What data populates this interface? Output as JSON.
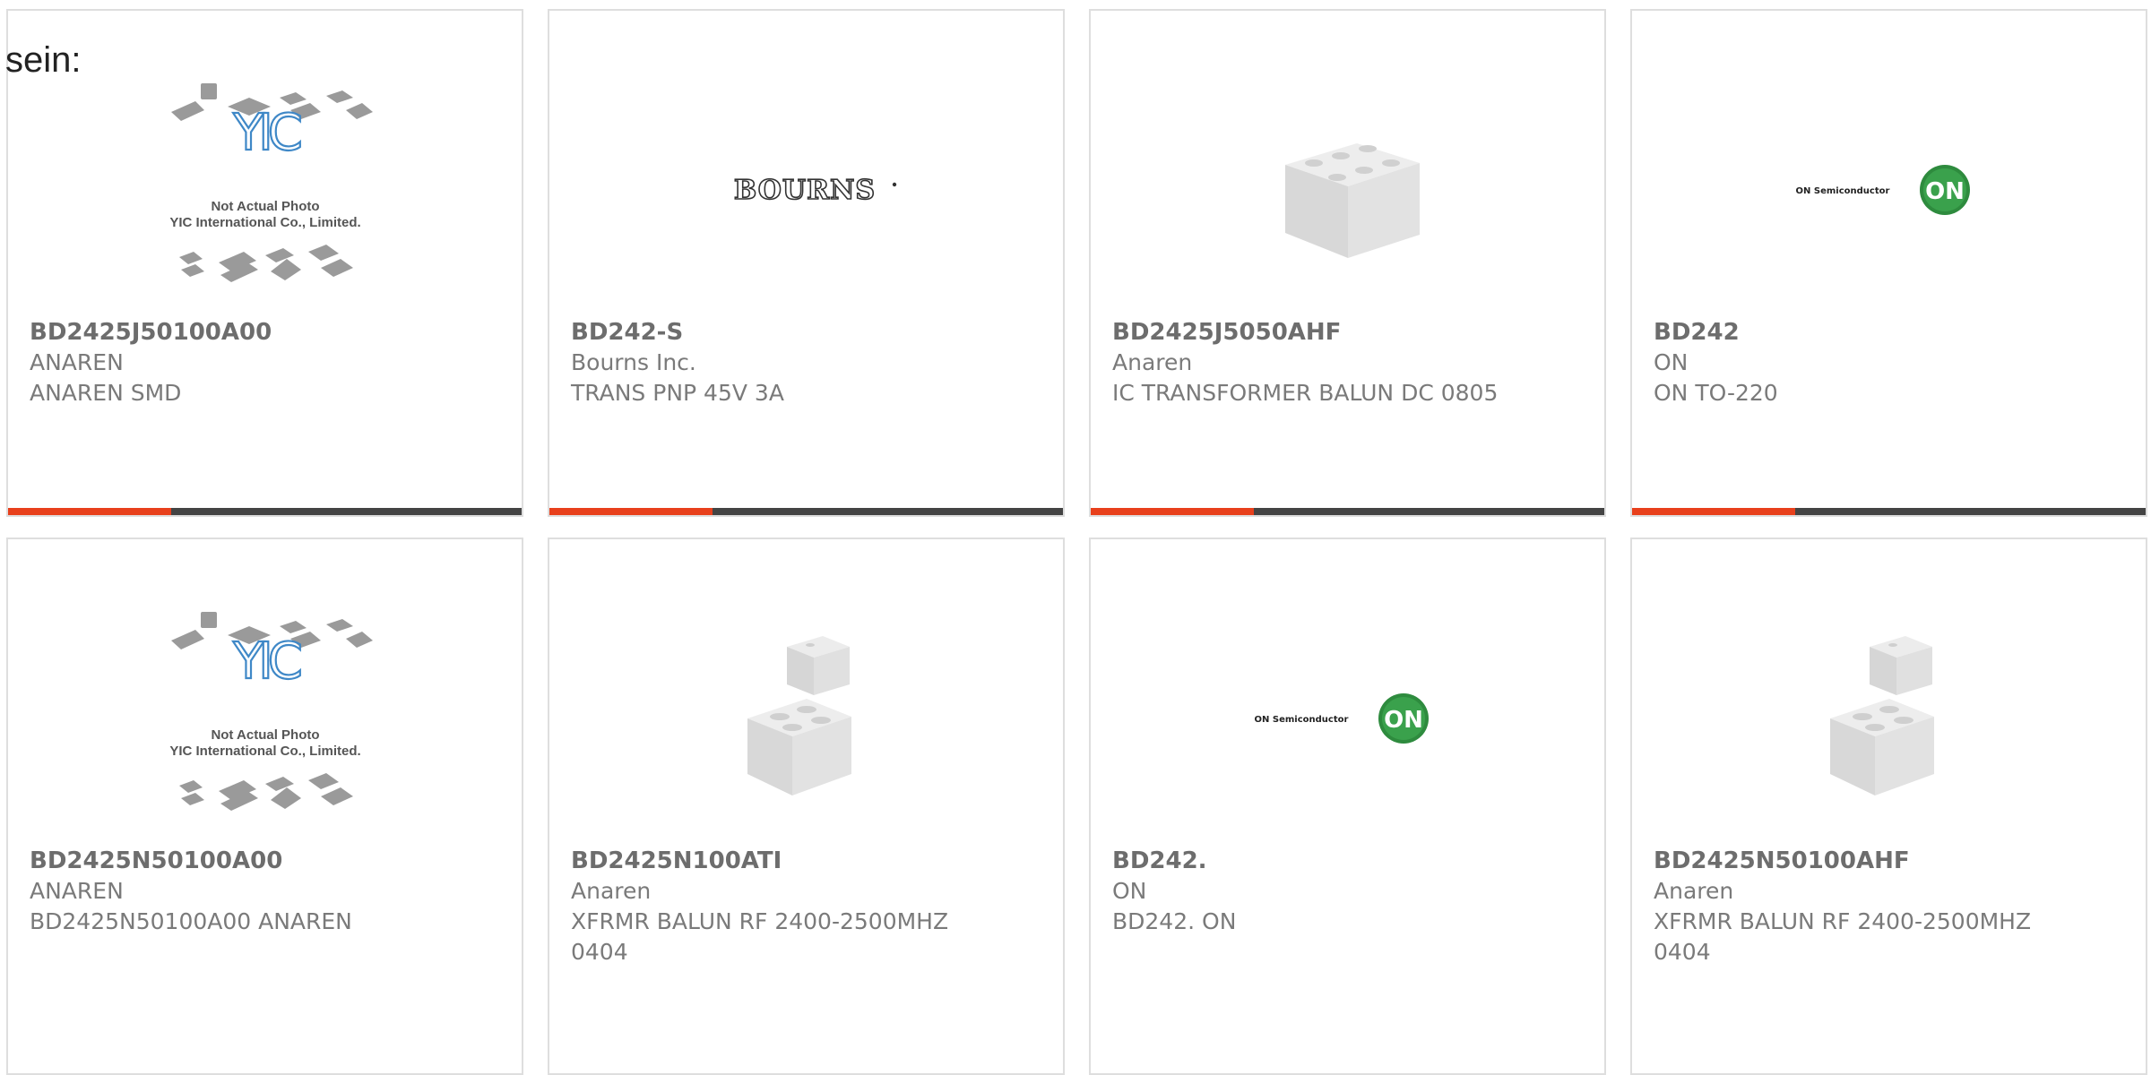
{
  "intro_text": "sein:",
  "colors": {
    "accent": "#e8401c",
    "bar": "#444444",
    "border": "#dedede"
  },
  "products": [
    {
      "part": "BD2425J50100A00",
      "manufacturer": "ANAREN",
      "description": "ANAREN SMD",
      "image": "yic-placeholder",
      "yic_lines": [
        "Not Actual Photo",
        "YIC International Co., Limited."
      ]
    },
    {
      "part": "BD242-S",
      "manufacturer": "Bourns Inc.",
      "description": "TRANS PNP 45V 3A",
      "image": "bourns-logo",
      "logo_text": "BOURNS"
    },
    {
      "part": "BD2425J5050AHF",
      "manufacturer": "Anaren",
      "description": "IC TRANSFORMER BALUN DC 0805",
      "image": "chip-6pad"
    },
    {
      "part": "BD242",
      "manufacturer": "ON",
      "description": "ON TO-220",
      "image": "on-semi-logo",
      "logo_text": "ON Semiconductor",
      "logo_badge": "ON"
    },
    {
      "part": "BD2425N50100A00",
      "manufacturer": "ANAREN",
      "description": "BD2425N50100A00 ANAREN",
      "image": "yic-placeholder",
      "yic_lines": [
        "Not Actual Photo",
        "YIC International Co., Limited."
      ]
    },
    {
      "part": "BD2425N100ATI",
      "manufacturer": "Anaren",
      "description": "XFRMR BALUN RF 2400-2500MHZ 0404",
      "image": "chip-cube"
    },
    {
      "part": "BD242.",
      "manufacturer": "ON",
      "description": "BD242. ON",
      "image": "on-semi-logo",
      "logo_text": "ON Semiconductor",
      "logo_badge": "ON"
    },
    {
      "part": "BD2425N50100AHF",
      "manufacturer": "Anaren",
      "description": "XFRMR BALUN RF 2400-2500MHZ 0404",
      "image": "chip-cube"
    }
  ]
}
